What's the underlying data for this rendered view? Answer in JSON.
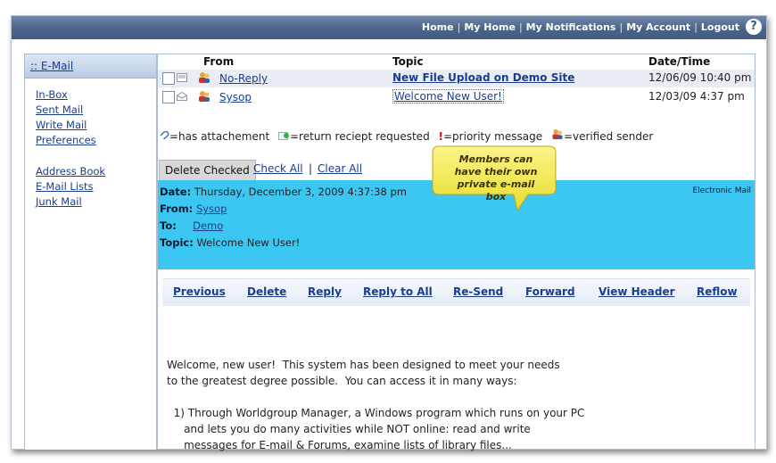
{
  "topnav": {
    "items": [
      "Home",
      "My Home",
      "My Notifications",
      "My Account",
      "Logout"
    ],
    "help": "?"
  },
  "sidebar": {
    "title": ":: E-Mail",
    "group1": [
      "In-Box",
      "Sent Mail",
      "Write Mail",
      "Preferences"
    ],
    "group2": [
      "Address Book",
      "E-Mail Lists",
      "Junk Mail"
    ]
  },
  "mail_list": {
    "headers": {
      "from": "From",
      "topic": "Topic",
      "date": "Date/Time"
    },
    "rows": [
      {
        "from": "No-Reply",
        "topic": "New File Upload on Demo Site",
        "date": "12/06/09 10:40 pm",
        "unread": true
      },
      {
        "from": "Sysop",
        "topic": "Welcome New User!",
        "date": "12/03/09 4:37 pm",
        "unread": false
      }
    ]
  },
  "legend": {
    "attachment": "=has attachement",
    "receipt": "=return reciept requested",
    "priority": "=priority message",
    "verified": "=verified sender"
  },
  "actions": {
    "delete": "Delete Checked",
    "check_all": "Check All",
    "separator": "|",
    "clear_all": "Clear All"
  },
  "message": {
    "date_label": "Date:",
    "date": "Thursday, December 3, 2009 4:37:38 pm",
    "from_label": "From:",
    "from": "Sysop",
    "to_label": "To:",
    "to": "Demo",
    "topic_label": "Topic:",
    "topic": "Welcome New User!",
    "type_label": "Electronic Mail"
  },
  "toolbar": [
    "Previous",
    "Delete",
    "Reply",
    "Reply to All",
    "Re-Send",
    "Forward",
    "View Header",
    "Reflow"
  ],
  "body_lines": [
    "Welcome, new user!  This system has been designed to meet your needs",
    "to the greatest degree possible.  You can access it in many ways:",
    "",
    "  1) Through Worldgroup Manager, a Windows program which runs on your PC",
    "     and lets you do many activities while NOT online: read and write",
    "     messages for E-mail & Forums, examine lists of library files..."
  ],
  "callout": {
    "text": "Members can have their own private e-mail box"
  },
  "colors": {
    "accent": "#3cc6f2",
    "topbar": "#4b6489",
    "link": "#1a3d8f",
    "callout": "#f3e94b"
  }
}
